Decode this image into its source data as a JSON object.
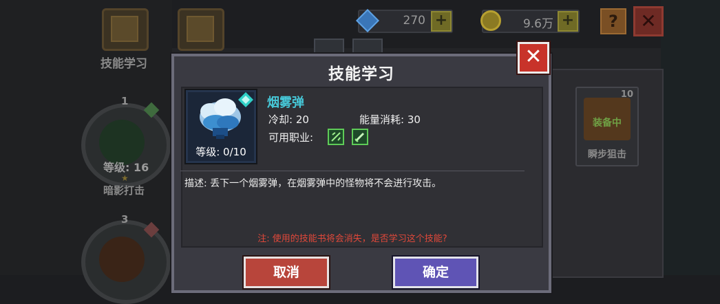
{
  "background": {
    "left_menu_label": "技能学习",
    "currency": {
      "gems": "270",
      "coins": "9.6万"
    },
    "help_label": "?",
    "close_label": "✕",
    "nodes": [
      {
        "num": "1",
        "level": "等级: 16",
        "name": "暗影打击"
      },
      {
        "num": "3"
      }
    ],
    "right_card": {
      "num": "10",
      "tag": "装备中",
      "name": "瞬步狙击"
    }
  },
  "dialog": {
    "title": "技能学习",
    "close_label": "✕",
    "skill": {
      "name": "烟雾弹",
      "level": "等级: 0/10",
      "cooldown": "冷却: 20",
      "energy": "能量消耗: 30",
      "classes_label": "可用职业:"
    },
    "description": "描述: 丢下一个烟雾弹，在烟雾弹中的怪物将不会进行攻击。",
    "note": "注: 使用的技能书将会消失，是否学习这个技能?",
    "cancel_label": "取消",
    "confirm_label": "确定"
  },
  "colors": {
    "skill_name": "#46c6d6",
    "note": "#e0483a",
    "cancel": "#b8453b",
    "confirm": "#5f54b5",
    "close": "#c8332a"
  },
  "icons": [
    "gem-icon",
    "coin-icon",
    "plus-icon",
    "help-icon",
    "close-icon",
    "smoke-bomb-icon",
    "bow-icon",
    "sword-icon",
    "diamond-icon"
  ]
}
